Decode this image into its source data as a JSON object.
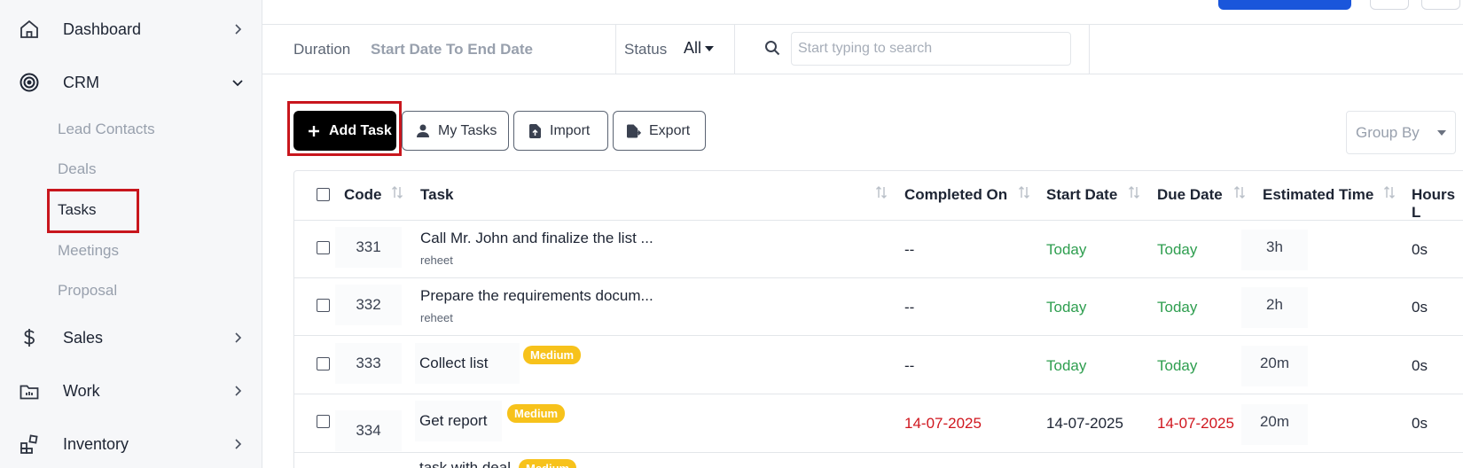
{
  "sidebar": {
    "items": [
      {
        "label": "Dashboard",
        "icon": "home-icon"
      },
      {
        "label": "CRM",
        "icon": "target-icon",
        "expanded": true
      },
      {
        "label": "Sales",
        "icon": "dollar-icon"
      },
      {
        "label": "Work",
        "icon": "briefcase-icon"
      },
      {
        "label": "Inventory",
        "icon": "inventory-icon"
      }
    ],
    "crm_subitems": [
      {
        "label": "Lead Contacts"
      },
      {
        "label": "Deals"
      },
      {
        "label": "Tasks",
        "active": true
      },
      {
        "label": "Meetings"
      },
      {
        "label": "Proposal"
      }
    ]
  },
  "filters": {
    "duration_label": "Duration",
    "duration_value": "Start Date To End Date",
    "status_label": "Status",
    "status_value": "All",
    "search_placeholder": "Start typing to search"
  },
  "actions": {
    "add_task": "Add Task",
    "my_tasks": "My Tasks",
    "import": "Import",
    "export": "Export",
    "group_by": "Group By"
  },
  "table": {
    "headers": {
      "code": "Code",
      "task": "Task",
      "completed_on": "Completed On",
      "start_date": "Start Date",
      "due_date": "Due Date",
      "estimated_time": "Estimated Time",
      "hours_logged": "Hours L"
    },
    "rows": [
      {
        "code": "331",
        "task": "Call Mr. John and finalize the list ...",
        "subtext": "reheet",
        "badge": "",
        "completed_on": "--",
        "start_date": "Today",
        "due_date": "Today",
        "estimated_time": "3h",
        "hours_logged": "0s"
      },
      {
        "code": "332",
        "task": "Prepare the requirements docum...",
        "subtext": "reheet",
        "badge": "",
        "completed_on": "--",
        "start_date": "Today",
        "due_date": "Today",
        "estimated_time": "2h",
        "hours_logged": "0s"
      },
      {
        "code": "333",
        "task": "Collect list",
        "subtext": "",
        "badge": "Medium",
        "completed_on": "--",
        "start_date": "Today",
        "due_date": "Today",
        "estimated_time": "20m",
        "hours_logged": "0s"
      },
      {
        "code": "334",
        "task": "Get report",
        "subtext": "",
        "badge": "Medium",
        "completed_on": "14-07-2025",
        "start_date": "14-07-2025",
        "due_date": "14-07-2025",
        "estimated_time": "20m",
        "hours_logged": "0s"
      },
      {
        "code": "",
        "task": "task with deal",
        "subtext": "",
        "badge": "Medium"
      }
    ]
  },
  "colors": {
    "accent": "#1a56db",
    "highlight_border": "#c8161d",
    "today_green": "#2e9e4f",
    "overdue_red": "#d0161e",
    "badge_medium": "#f7c21b"
  }
}
